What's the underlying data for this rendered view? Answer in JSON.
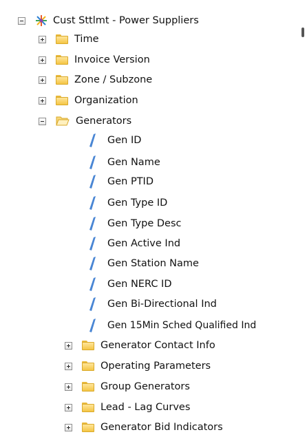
{
  "tree": {
    "root": {
      "label": "Cust Sttlmt - Power Suppliers",
      "icon": "cube-icon",
      "expanded": true
    },
    "folders": [
      {
        "label": "Time",
        "expanded": false
      },
      {
        "label": "Invoice Version",
        "expanded": false
      },
      {
        "label": "Zone / Subzone",
        "expanded": false
      },
      {
        "label": "Organization",
        "expanded": false
      },
      {
        "label": "Generators",
        "expanded": true
      }
    ],
    "generator_fields": [
      "Gen ID",
      "Gen Name",
      "Gen PTID",
      "Gen Type ID",
      "Gen Type Desc",
      "Gen Active Ind",
      "Gen Station Name",
      "Gen NERC ID",
      "Gen Bi-Directional Ind",
      "Gen 15Min Sched Qualified Ind"
    ],
    "generator_subfolders": [
      {
        "label": "Generator Contact Info",
        "expanded": false
      },
      {
        "label": "Operating Parameters",
        "expanded": false
      },
      {
        "label": "Group Generators",
        "expanded": false
      },
      {
        "label": "Lead - Lag Curves",
        "expanded": false
      },
      {
        "label": "Generator Bid Indicators",
        "expanded": false
      }
    ]
  },
  "colors": {
    "folder_fill": "#f4c545",
    "measure_blue": "#4a86d4",
    "toggle_border": "#8c8c8c"
  }
}
